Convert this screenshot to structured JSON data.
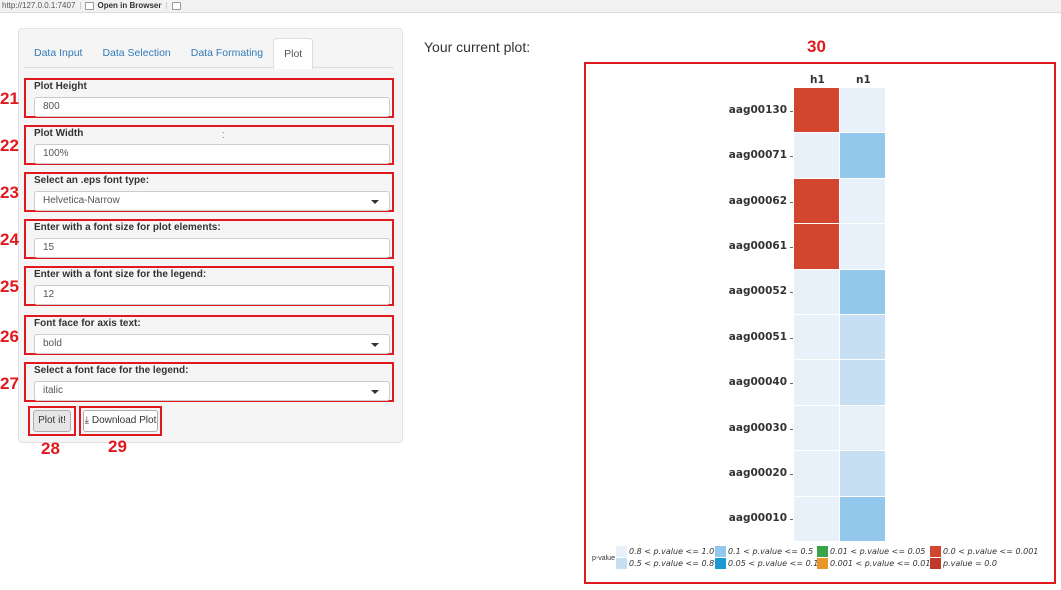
{
  "browser": {
    "url": "http://127.0.0.1:7407",
    "open_label": "Open in Browser"
  },
  "tabs": [
    {
      "label": "Data Input",
      "active": false
    },
    {
      "label": "Data Selection",
      "active": false
    },
    {
      "label": "Data Formating",
      "active": false
    },
    {
      "label": "Plot",
      "active": true
    }
  ],
  "fields": [
    {
      "num": "21",
      "label": "Plot Height",
      "value": "800",
      "type": "text"
    },
    {
      "num": "22",
      "label": "Plot Width",
      "value": "100%",
      "type": "text"
    },
    {
      "num": "23",
      "label": "Select an .eps font type:",
      "value": "Helvetica-Narrow",
      "type": "select"
    },
    {
      "num": "24",
      "label": "Enter with a font size for plot elements:",
      "value": "15",
      "type": "text"
    },
    {
      "num": "25",
      "label": "Enter with a font size for the legend:",
      "value": "12",
      "type": "text"
    },
    {
      "num": "26",
      "label": "Font face for axis text:",
      "value": "bold",
      "type": "select"
    },
    {
      "num": "27",
      "label": "Select a font face for the legend:",
      "value": "italic",
      "type": "select"
    }
  ],
  "buttons": {
    "plot_label": "Plot it!",
    "plot_num": "28",
    "download_label": "Download Plot",
    "download_num": "29"
  },
  "plot": {
    "heading": "Your current plot:",
    "num": "30"
  },
  "chart_data": {
    "type": "heatmap",
    "columns": [
      "h1",
      "n1"
    ],
    "rows": [
      "aag00130",
      "aag00071",
      "aag00062",
      "aag00061",
      "aag00052",
      "aag00051",
      "aag00040",
      "aag00030",
      "aag00020",
      "aag00010"
    ],
    "cells": [
      [
        "0.0 < p.value <= 0.001",
        "0.8 < p.value <= 1.0"
      ],
      [
        "0.8 < p.value <= 1.0",
        "0.1 < p.value <= 0.5"
      ],
      [
        "0.0 < p.value <= 0.001",
        "0.8 < p.value <= 1.0"
      ],
      [
        "0.0 < p.value <= 0.001",
        "0.8 < p.value <= 1.0"
      ],
      [
        "0.8 < p.value <= 1.0",
        "0.1 < p.value <= 0.5"
      ],
      [
        "0.8 < p.value <= 1.0",
        "0.5 < p.value <= 0.8"
      ],
      [
        "0.8 < p.value <= 1.0",
        "0.5 < p.value <= 0.8"
      ],
      [
        "0.8 < p.value <= 1.0",
        "0.8 < p.value <= 1.0"
      ],
      [
        "0.8 < p.value <= 1.0",
        "0.5 < p.value <= 0.8"
      ],
      [
        "0.8 < p.value <= 1.0",
        "0.1 < p.value <= 0.5"
      ]
    ],
    "legend_title": "p-value",
    "legend": [
      {
        "label": "0.8 < p.value <= 1.0",
        "color": "#e8f0fa"
      },
      {
        "label": "0.5 < p.value <= 0.8",
        "color": "#c6dff3"
      },
      {
        "label": "0.1 < p.value <= 0.5",
        "color": "#93c8ec"
      },
      {
        "label": "0.05 < p.value <= 0.1",
        "color": "#1c9ad6"
      },
      {
        "label": "0.01 < p.value <= 0.05",
        "color": "#3aa44a"
      },
      {
        "label": "0.001 < p.value <= 0.01",
        "color": "#e8962a"
      },
      {
        "label": "0.0 < p.value <= 0.001",
        "color": "#d2452f"
      },
      {
        "label": "p.value = 0.0",
        "color": "#c0392b"
      }
    ],
    "legend_placement": "bottom"
  },
  "colors": {
    "annotation": "#e0191f",
    "link": "#337ab7"
  }
}
